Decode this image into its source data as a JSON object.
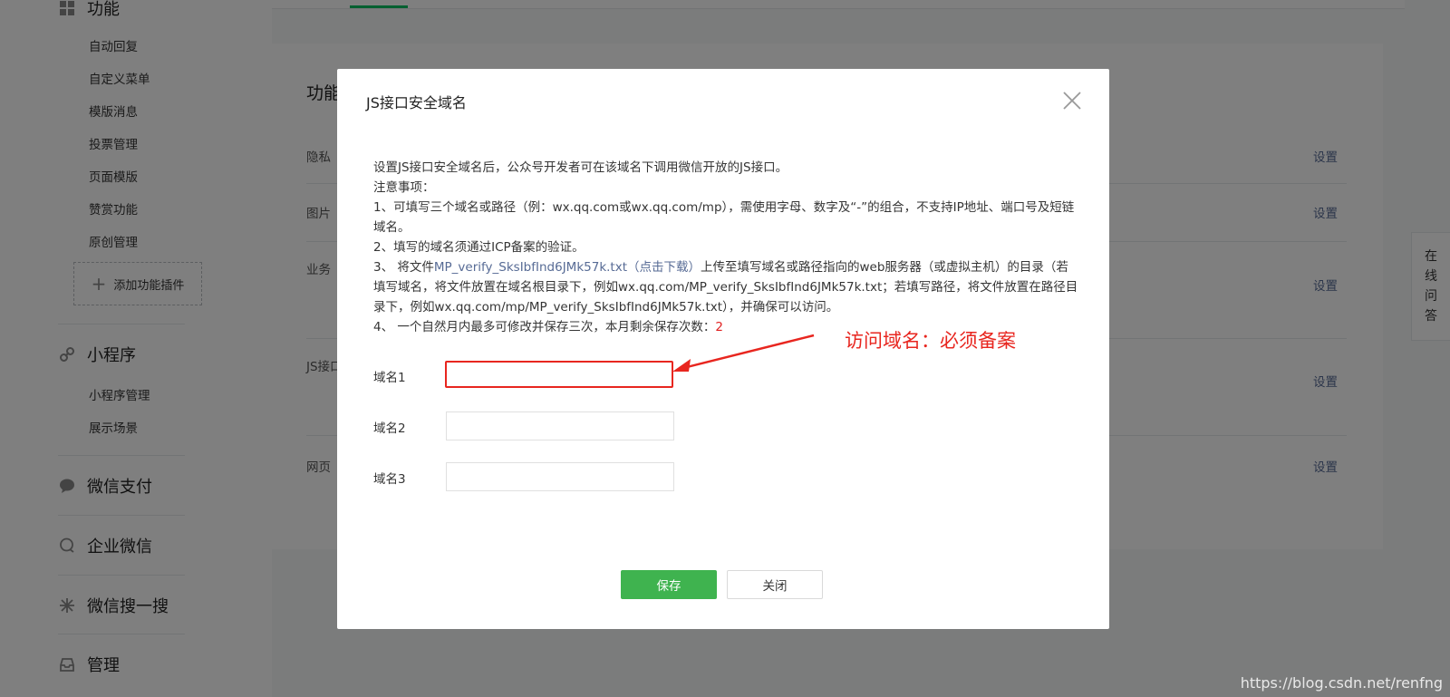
{
  "sidebar": {
    "section_function": {
      "label": "功能",
      "icon": "grid-icon"
    },
    "function_items": [
      "自动回复",
      "自定义菜单",
      "模版消息",
      "投票管理",
      "页面模版",
      "赞赏功能",
      "原创管理"
    ],
    "add_plugin": "添加功能插件",
    "section_miniprogram": {
      "label": "小程序",
      "icon": "link-icon"
    },
    "miniprogram_items": [
      "小程序管理",
      "展示场景"
    ],
    "section_pay": {
      "label": "微信支付",
      "icon": "chat-bubble-icon"
    },
    "section_work": {
      "label": "企业微信",
      "icon": "speech-bubble-icon"
    },
    "section_search": {
      "label": "微信搜一搜",
      "icon": "sparkle-icon"
    },
    "section_manage": {
      "label": "管理",
      "icon": "inbox-icon"
    }
  },
  "main": {
    "card_title": "功能",
    "rows": [
      {
        "label": "隐私",
        "setting": "设置"
      },
      {
        "label": "图片",
        "setting": "设置"
      },
      {
        "label": "业务",
        "setting": "设置"
      },
      {
        "label": "JS接口",
        "setting": "设置"
      },
      {
        "label": "网页",
        "setting": "设置"
      }
    ]
  },
  "qa_tab": [
    "在",
    "线",
    "问",
    "答"
  ],
  "dialog": {
    "title": "JS接口安全域名",
    "intro": "设置JS接口安全域名后，公众号开发者可在该域名下调用微信开放的JS接口。",
    "notes_heading": "注意事项：",
    "note1": "1、可填写三个域名或路径（例：wx.qq.com或wx.qq.com/mp），需使用字母、数字及“-”的组合，不支持IP地址、端口号及短链域名。",
    "note2": "2、填写的域名须通过ICP备案的验证。",
    "note3_prefix": "3、 将文件",
    "note3_filename": "MP_verify_SksIbfInd6JMk57k.txt",
    "note3_download": "（点击下载）",
    "note3_suffix": "上传至填写域名或路径指向的web服务器（或虚拟主机）的目录（若填写域名，将文件放置在域名根目录下，例如wx.qq.com/MP_verify_SksIbfInd6JMk57k.txt；若填写路径，将文件放置在路径目录下，例如wx.qq.com/mp/MP_verify_SksIbfInd6JMk57k.txt），并确保可以访问。",
    "note4_prefix": "4、 一个自然月内最多可修改并保存三次，本月剩余保存次数：",
    "note4_count": "2",
    "fields": [
      {
        "label": "域名1",
        "value": ""
      },
      {
        "label": "域名2",
        "value": ""
      },
      {
        "label": "域名3",
        "value": ""
      }
    ],
    "save_label": "保存",
    "close_label": "关闭"
  },
  "annotation": "访问域名：必须备案",
  "watermark": "https://blog.csdn.net/renfng",
  "colors": {
    "accent_green": "#3fb34f",
    "annotation_red": "#e8261f",
    "link_blue": "#576b95"
  }
}
